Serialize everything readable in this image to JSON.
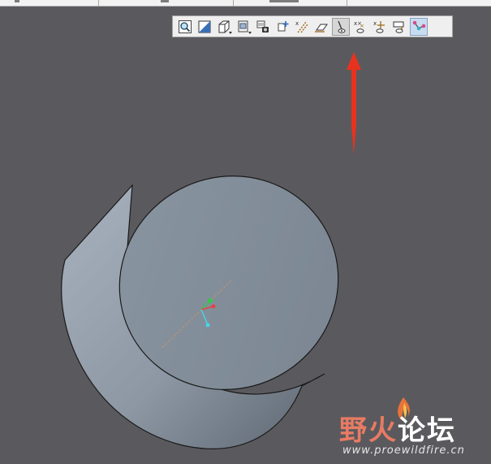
{
  "toolbar": {
    "buttons": [
      {
        "name": "zoom-refit-icon"
      },
      {
        "name": "repaint-icon"
      },
      {
        "name": "display-style-icon"
      },
      {
        "name": "saved-orientations-icon"
      },
      {
        "name": "view-manager-icon"
      },
      {
        "name": "spin-center-icon"
      },
      {
        "name": "datum-axis-display-icon"
      },
      {
        "name": "datum-plane-display-icon"
      },
      {
        "name": "datum-axis-visibility-icon"
      },
      {
        "name": "datum-point-display-icon"
      },
      {
        "name": "coordinate-system-display-icon"
      },
      {
        "name": "annotation-display-icon"
      },
      {
        "name": "sketch-display-icon"
      }
    ]
  },
  "annotation": {
    "arrow_color": "#e8321e"
  },
  "watermark": {
    "text_part1": "野",
    "text_part2": "火",
    "text_part3": "论坛",
    "url": "www.proewildfire.cn"
  },
  "colors": {
    "background": "#5a5a5e",
    "model_top": "#7f8b96",
    "model_side": "#9aa6b3"
  }
}
